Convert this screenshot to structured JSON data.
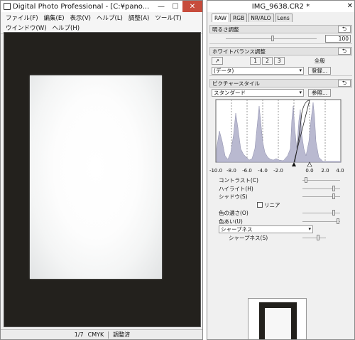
{
  "main_window": {
    "title": "Digital Photo Professional - [C:¥pano...",
    "controls": {
      "minimize": "—",
      "maximize": "☐",
      "close": "✕"
    },
    "menu": [
      "ファイル(F)",
      "編集(E)",
      "表示(V)",
      "ヘルプ(L)",
      "調整(A)",
      "ツール(T)",
      "ウインドウ(W)",
      "ヘルプ(H)"
    ],
    "status": {
      "zoom": "1/7",
      "color_mode": "CMYK",
      "state": "調整済"
    }
  },
  "tool_palette": {
    "title": "IMG_9638.CR2 *",
    "close": "✕",
    "tabs": [
      "RAW",
      "RGB",
      "NR/ALO",
      "Lens"
    ],
    "active_tab": "RAW",
    "brightness": {
      "header": "明るさ調整",
      "value": "100",
      "level": 0.5
    },
    "white_balance": {
      "header": "ホワイトバランス調整",
      "label": "全般",
      "boxes": [
        "1",
        "2",
        "3"
      ],
      "select": "(データ)",
      "register": "登録..."
    },
    "picture_style": {
      "header": "ピクチャースタイル",
      "select": "スタンダード",
      "browse": "参照..."
    },
    "histogram": {
      "axis_labels": [
        "-10.0",
        "-8.0",
        "-6.0",
        "-4.0",
        "-2.0",
        "0.0",
        "2.0",
        "4.0"
      ]
    },
    "params": [
      {
        "label": "コントラスト(C)",
        "level": 0.05
      },
      {
        "label": "ハイライト(H)",
        "level": 0.8
      },
      {
        "label": "シャドウ(S)",
        "level": 0.8
      },
      {
        "label": "リニア",
        "type": "checkbox"
      },
      {
        "label": "色の濃さ(O)",
        "level": 0.8
      },
      {
        "label": "色あい(U)",
        "level": 0.9
      }
    ],
    "sharpness": {
      "select": "シャープネス",
      "label": "シャープネス(S)",
      "level": 0.6
    }
  },
  "colors": {
    "viewer_bg": "#23211d",
    "close_btn": "#c74c3c"
  }
}
